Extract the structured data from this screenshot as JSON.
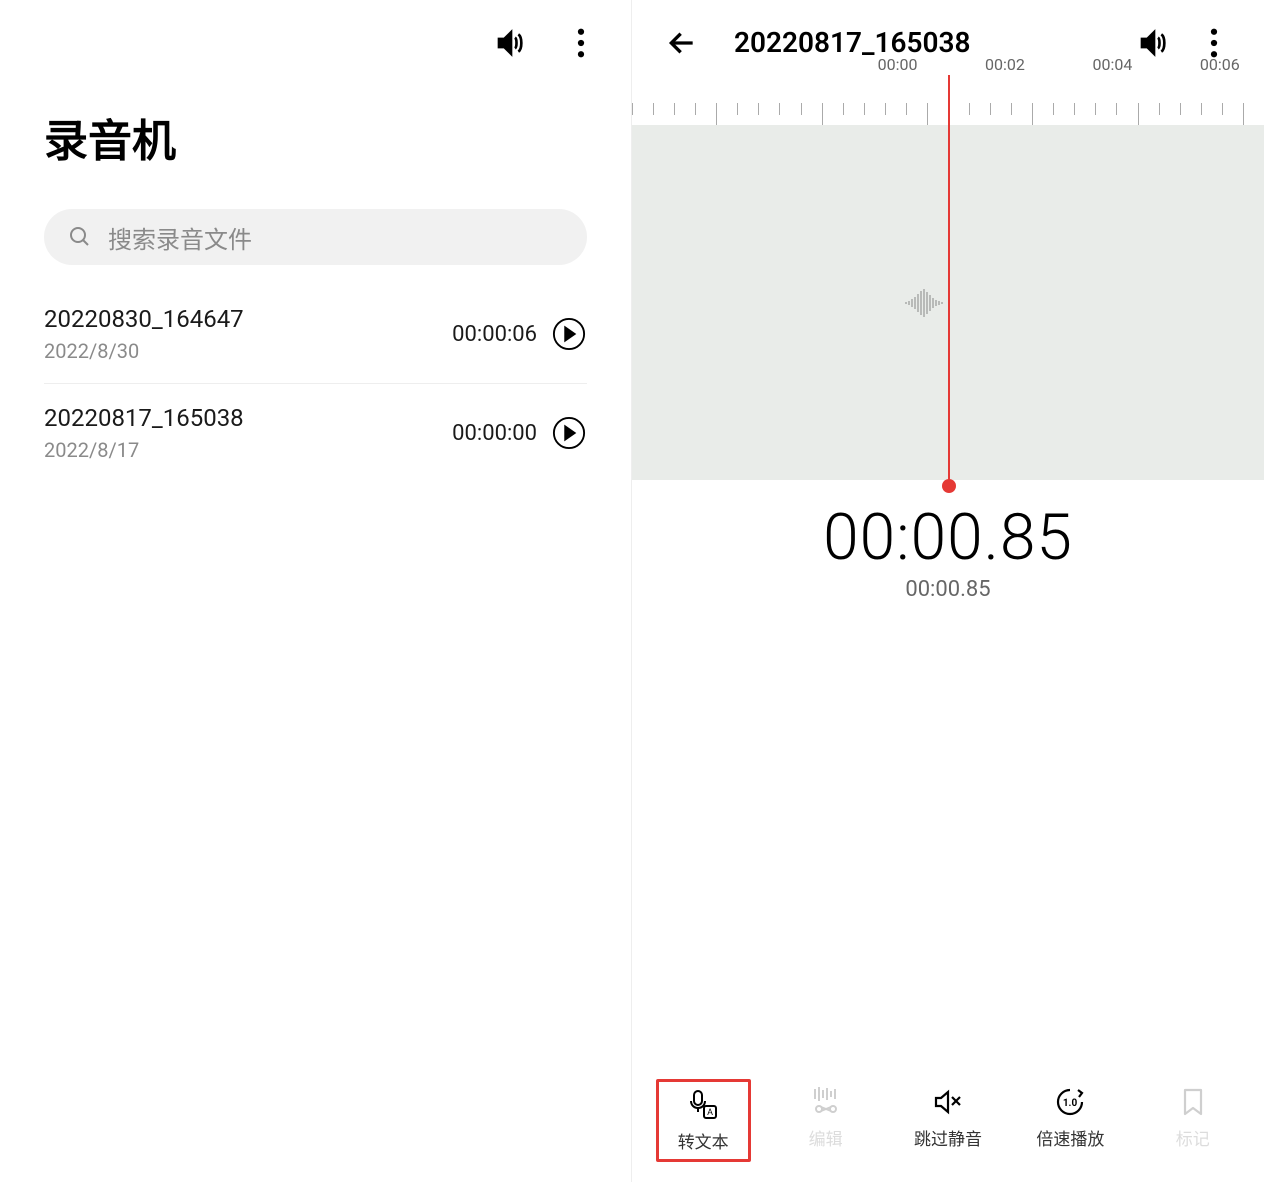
{
  "left": {
    "title": "录音机",
    "search_placeholder": "搜索录音文件",
    "recordings": [
      {
        "name": "20220830_164647",
        "date": "2022/8/30",
        "duration": "00:00:06"
      },
      {
        "name": "20220817_165038",
        "date": "2022/8/17",
        "duration": "00:00:00"
      }
    ]
  },
  "right": {
    "title": "20220817_165038",
    "ruler_labels": [
      "00:00",
      "00:02",
      "00:04",
      "00:06"
    ],
    "time_main": "00:00.85",
    "time_sub": "00:00.85",
    "toolbar": [
      {
        "label": "转文本",
        "icon": "transcribe",
        "selected": true,
        "disabled": false
      },
      {
        "label": "编辑",
        "icon": "edit",
        "selected": false,
        "disabled": true
      },
      {
        "label": "跳过静音",
        "icon": "mute-skip",
        "selected": false,
        "disabled": false
      },
      {
        "label": "倍速播放",
        "icon": "speed",
        "selected": false,
        "disabled": false
      },
      {
        "label": "标记",
        "icon": "bookmark",
        "selected": false,
        "disabled": true
      }
    ]
  }
}
